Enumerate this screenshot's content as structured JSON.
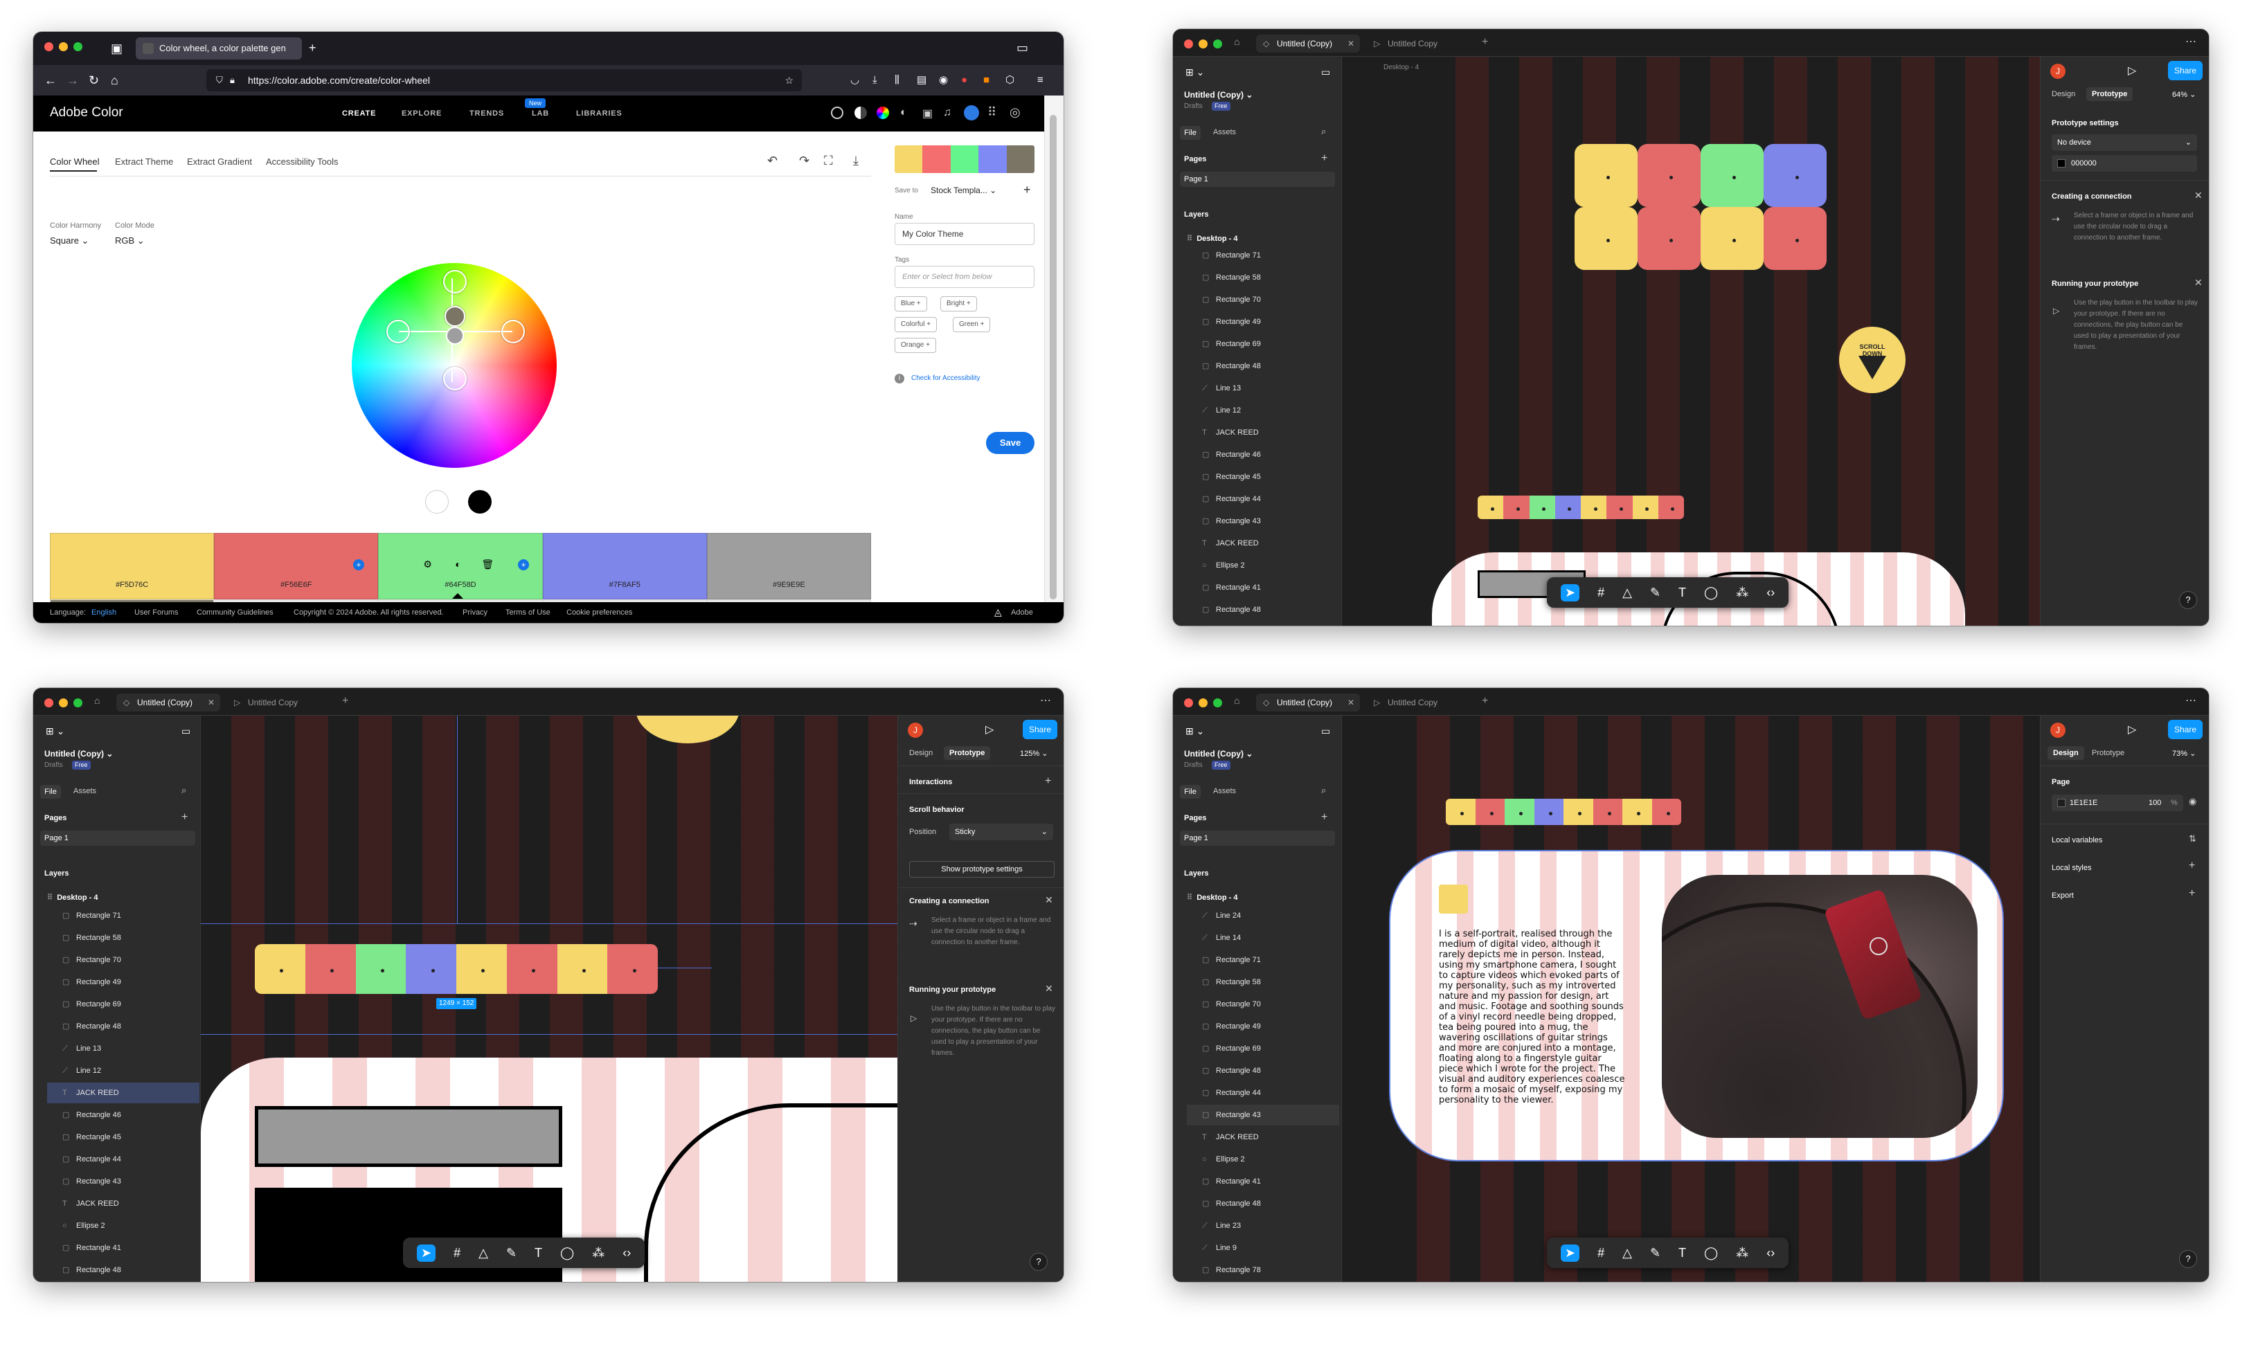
{
  "adobe": {
    "tab_title": "Color wheel, a color palette gen",
    "url": "https://color.adobe.com/create/color-wheel",
    "brand": "Adobe Color",
    "nav": [
      "CREATE",
      "EXPLORE",
      "TRENDS",
      "LAB",
      "LIBRARIES"
    ],
    "nav_badge": "New",
    "tabs": [
      "Color Wheel",
      "Extract Theme",
      "Extract Gradient",
      "Accessibility Tools"
    ],
    "harmony_label": "Color Harmony",
    "harmony_value": "Square",
    "mode_label": "Color Mode",
    "mode_value": "RGB",
    "swatches": [
      {
        "hex": "#F5D76C",
        "color": "#f5d76c"
      },
      {
        "hex": "#F56E6F",
        "color": "#e46a6a"
      },
      {
        "hex": "#64F58D",
        "color": "#7ee88c"
      },
      {
        "hex": "#7F8AF5",
        "color": "#7f86ea"
      },
      {
        "hex": "#9E9E9E",
        "color": "#9e9e9e"
      }
    ],
    "theme_strip": [
      "#f5d76c",
      "#f56e6f",
      "#64f58d",
      "#7f8af5",
      "#7a7565"
    ],
    "save_to_label": "Save to",
    "save_to_value": "Stock Templa...",
    "name_label": "Name",
    "name_value": "My Color Theme",
    "tags_label": "Tags",
    "tags_placeholder": "Enter or Select from below",
    "tags": [
      "Blue",
      "Bright",
      "Colorful",
      "Green",
      "Orange"
    ],
    "check_accessibility": "Check for Accessibility",
    "save_button": "Save",
    "footer": {
      "language_label": "Language:",
      "language_value": "English",
      "links": [
        "User Forums",
        "Community Guidelines",
        "Copyright © 2024 Adobe. All rights reserved.",
        "Privacy",
        "Terms of Use",
        "Cookie preferences"
      ],
      "brand": "Adobe"
    }
  },
  "figma_common": {
    "tab_active": "Untitled (Copy)",
    "tab_second": "Untitled Copy",
    "file_name": "Untitled (Copy)",
    "drafts": "Drafts",
    "free_badge": "Free",
    "file_tab": "File",
    "assets_tab": "Assets",
    "pages_label": "Pages",
    "page_1": "Page 1",
    "layers_label": "Layers",
    "frame_name": "Desktop - 4",
    "avatar_initial": "J",
    "share": "Share",
    "design_tab": "Design",
    "prototype_tab": "Prototype",
    "help": "?"
  },
  "figma_tr": {
    "canvas_frame_label": "Desktop - 4",
    "zoom": "64%",
    "layers": [
      "Rectangle 71",
      "Rectangle 58",
      "Rectangle 70",
      "Rectangle 49",
      "Rectangle 69",
      "Rectangle 48",
      "Line 13",
      "Line 12",
      "JACK REED",
      "Rectangle 46",
      "Rectangle 45",
      "Rectangle 44",
      "Rectangle 43",
      "JACK REED",
      "Ellipse 2",
      "Rectangle 41",
      "Rectangle 48"
    ],
    "prototype_settings": "Prototype settings",
    "device": "No device",
    "bg_color": "000000",
    "creating_title": "Creating a connection",
    "creating_desc": "Select a frame or object in a frame and use the circular node to drag a connection to another frame.",
    "running_title": "Running your prototype",
    "running_desc": "Use the play button in the toolbar to play your prototype. If there are no connections, the play button can be used to play a presentation of your frames.",
    "scroll_button": "SCROLL DOWN"
  },
  "figma_bl": {
    "zoom": "125%",
    "layers": [
      "Rectangle 71",
      "Rectangle 58",
      "Rectangle 70",
      "Rectangle 49",
      "Rectangle 69",
      "Rectangle 48",
      "Line 13",
      "Line 12",
      "JACK REED",
      "Rectangle 46",
      "Rectangle 45",
      "Rectangle 44",
      "Rectangle 43",
      "JACK REED",
      "Ellipse 2",
      "Rectangle 41",
      "Rectangle 48"
    ],
    "selected_index": 8,
    "interactions": "Interactions",
    "scroll_behavior": "Scroll behavior",
    "position_label": "Position",
    "position_value": "Sticky",
    "show_settings": "Show prototype settings",
    "creating_title": "Creating a connection",
    "creating_desc": "Select a frame or object in a frame and use the circular node to drag a connection to another frame.",
    "running_title": "Running your prototype",
    "running_desc": "Use the play button in the toolbar to play your prototype. If there are no connections, the play button can be used to play a presentation of your frames.",
    "size_badge": "1249 × 152"
  },
  "figma_br": {
    "zoom": "73%",
    "layers": [
      "Line 24",
      "Line 14",
      "Rectangle 71",
      "Rectangle 58",
      "Rectangle 70",
      "Rectangle 49",
      "Rectangle 69",
      "Rectangle 48",
      "Rectangle 44",
      "Rectangle 43",
      "JACK REED",
      "Ellipse 2",
      "Rectangle 41",
      "Rectangle 48",
      "Line 23",
      "Line 9",
      "Rectangle 78"
    ],
    "hover_index": 9,
    "page_label": "Page",
    "page_color": "1E1E1E",
    "page_opacity": "100",
    "percent": "%",
    "local_variables": "Local variables",
    "local_styles": "Local styles",
    "export": "Export",
    "bio": "I is a self-portrait, realised through the medium of digital video, although it rarely depicts me in person. Instead, using my smartphone camera, I sought to capture videos which evoked parts of my personality, such as my introverted nature and my passion for design, art and music. Footage and soothing sounds of a vinyl record needle being dropped, tea being poured into a mug, the wavering oscillations of guitar strings and more are conjured into a montage, floating along to a fingerstyle guitar piece which I wrote for the project. The visual and auditory experiences coalesce to form a mosaic of myself, exposing my personality to the viewer."
  },
  "palette": [
    "#f5d76c",
    "#e46a6a",
    "#7ee88c",
    "#7f86ea",
    "#f5d76c",
    "#e46a6a"
  ]
}
